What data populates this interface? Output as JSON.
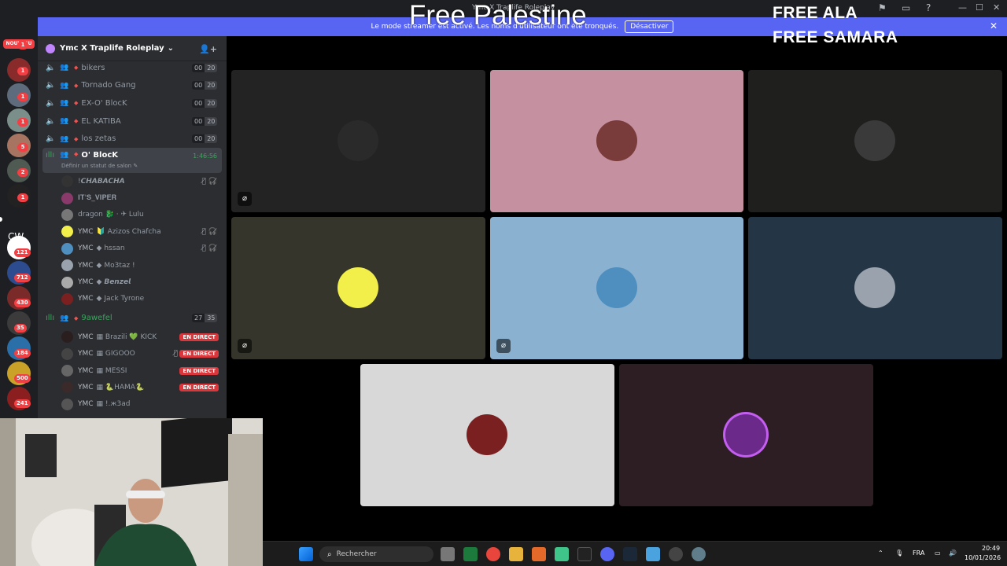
{
  "window": {
    "title": "Ymc X Traplife Roleplay",
    "controls": [
      "—",
      "☐",
      "✕"
    ]
  },
  "titlebar_icons": [
    "inbox-icon",
    "screen-icon",
    "help-icon"
  ],
  "banner": {
    "message": "Le mode streamer est activé. Les noms d'utilisateur ont été tronqués.",
    "button": "Désactiver",
    "close": "✕"
  },
  "overlays": {
    "big": "Free Palestine",
    "line1": "FREE ALA",
    "line2": "FREE SAMARA"
  },
  "rail": {
    "nouveau": "NOUVEAU",
    "badges": [
      "1",
      "1",
      "1",
      "1",
      "5",
      "2",
      "1",
      "121",
      "712",
      "430",
      "35",
      "184",
      "500",
      "241"
    ],
    "cw": "CW"
  },
  "server": {
    "name": "Ymc X Traplife Roleplay",
    "chevron": "⌄",
    "add_icon": "👤+"
  },
  "voice_channels": [
    {
      "name": "bikers",
      "c1": "00",
      "c2": "20"
    },
    {
      "name": "Tornado Gang",
      "c1": "00",
      "c2": "20"
    },
    {
      "name": "EX-O' BlocK",
      "c1": "00",
      "c2": "20"
    },
    {
      "name": "EL KATIBA",
      "c1": "00",
      "c2": "20"
    },
    {
      "name": "los zetas",
      "c1": "00",
      "c2": "20"
    }
  ],
  "active_channel": {
    "name": "O' BlocK",
    "timer": "1:46:56",
    "status": "Définir un statut de salon ✎"
  },
  "active_members": [
    {
      "tag": "",
      "name": "!𝘾𝙃𝘼𝘽𝘼𝘾𝙃𝘼",
      "mic": "🎙̸ 🎧̸"
    },
    {
      "tag": "",
      "name": "𝐈𝐓'𝐒_𝐕𝐈𝐏𝐄𝐑",
      "mic": ""
    },
    {
      "tag": "",
      "name": "dragon 🐉 · ✈ Lulu",
      "mic": ""
    },
    {
      "tag": "YMC",
      "name": "🔰 Azizos Chafcha",
      "mic": "🎙̸ 🎧̸"
    },
    {
      "tag": "YMC",
      "name": "◆ hssan",
      "mic": "🎙̸ 🎧̸"
    },
    {
      "tag": "YMC",
      "name": "◆ Mo3taz !",
      "mic": ""
    },
    {
      "tag": "YMC",
      "name": "◆ 𝘽𝙚𝙣𝙯𝙚𝙡",
      "mic": ""
    },
    {
      "tag": "YMC",
      "name": "◆ Jack Tyrone",
      "mic": ""
    }
  ],
  "second_channel": {
    "name": "9awefel",
    "c1": "27",
    "c2": "35"
  },
  "second_members": [
    {
      "tag": "YMC",
      "name": "▦ Brazili 💚 KICK",
      "live": "EN DIRECT",
      "mic": ""
    },
    {
      "tag": "YMC",
      "name": "▦ GIGOOO",
      "live": "EN DIRECT",
      "mic": "🎙̸"
    },
    {
      "tag": "YMC",
      "name": "▦ MESSI",
      "live": "EN DIRECT",
      "mic": ""
    },
    {
      "tag": "YMC",
      "name": "▦ 🐍HAMA🐍",
      "live": "EN DIRECT",
      "mic": ""
    },
    {
      "tag": "YMC",
      "name": "▦ !.ж3ad",
      "live": "",
      "mic": ""
    }
  ],
  "tiles": [
    {
      "bg": "#232323",
      "avatar": "#2a2a2a",
      "icon": true
    },
    {
      "bg": "#c5909f",
      "avatar": "#7a3b3b",
      "icon": false
    },
    {
      "bg": "#1f1f1d",
      "avatar": "#3a3a3a",
      "icon": false
    },
    {
      "bg": "#35352b",
      "avatar": "#f2ef4a",
      "icon": true
    },
    {
      "bg": "#8bb1d1",
      "avatar": "#4f8fbf",
      "icon": true
    },
    {
      "bg": "#243645",
      "avatar": "#9aa3ad",
      "icon": false
    },
    {
      "bg": "#d8d8d8",
      "avatar": "#7a2020",
      "icon": false
    },
    {
      "bg": "#2d1e23",
      "avatar": "#6b2a8a",
      "icon": false
    }
  ],
  "taskbar": {
    "search": "Rechercher",
    "lang": "FRA",
    "time": "20:49",
    "date": "10/01/2026"
  }
}
